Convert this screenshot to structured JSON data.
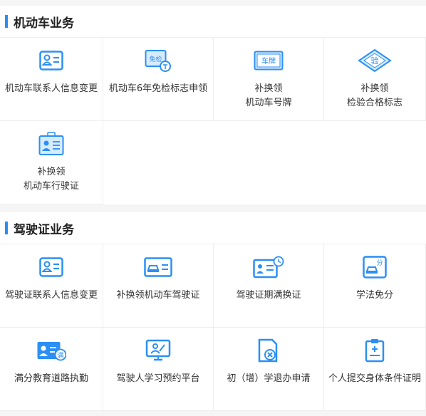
{
  "vehicle": {
    "title": "机动车业务",
    "items": [
      {
        "label": "机动车联系人信息变更",
        "label2": ""
      },
      {
        "label": "机动车6年免检标志申领",
        "label2": ""
      },
      {
        "label": "补换领",
        "label2": "机动车号牌"
      },
      {
        "label": "补换领",
        "label2": "检验合格标志"
      },
      {
        "label": "补换领",
        "label2": "机动车行驶证"
      }
    ],
    "icon_texts": {
      "exempt": "免检",
      "plate": "车牌",
      "inspect": "验"
    }
  },
  "license": {
    "title": "驾驶证业务",
    "items": [
      {
        "label": "驾驶证联系人信息变更"
      },
      {
        "label": "补换领机动车驾驶证"
      },
      {
        "label": "驾驶证期满换证"
      },
      {
        "label": "学法免分"
      },
      {
        "label": "满分教育道路执勤"
      },
      {
        "label": "驾驶人学习预约平台"
      },
      {
        "label": "初（增）学退办申请"
      },
      {
        "label": "个人提交身体条件证明"
      }
    ],
    "icon_texts": {
      "score": "分",
      "full": "满"
    }
  },
  "colors": {
    "accent": "#2d8cf0",
    "icon": "#2b8ff5",
    "iconLight": "#d7ebff"
  },
  "icons": [
    "contact-card-icon",
    "exempt-sticker-icon",
    "plate-icon",
    "inspect-diamond-icon",
    "license-badge-icon",
    "contact-card-icon",
    "license-card-icon",
    "license-renew-icon",
    "score-car-icon",
    "full-score-icon",
    "monitor-study-icon",
    "cancel-doc-icon",
    "clipboard-health-icon"
  ]
}
